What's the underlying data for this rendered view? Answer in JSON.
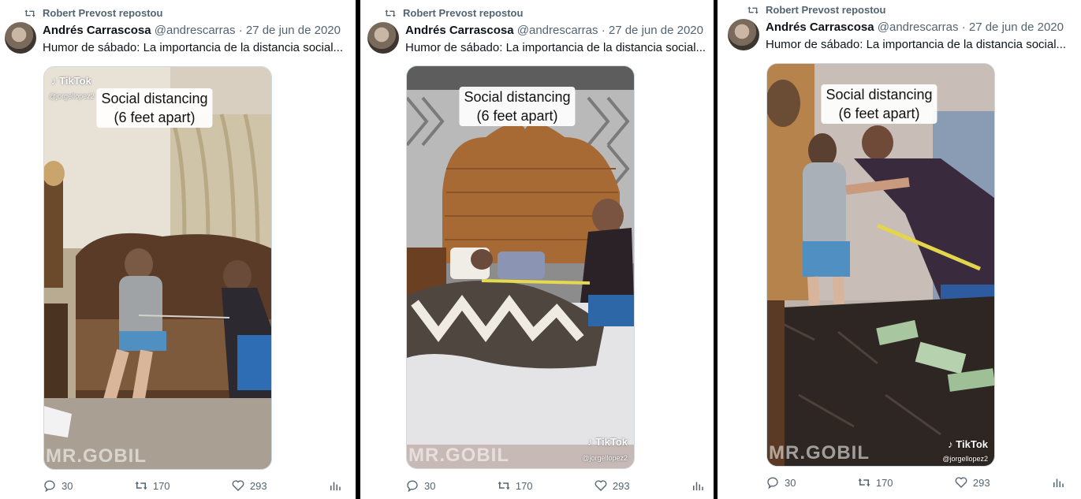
{
  "tweets": [
    {
      "repost_label": "Robert Prevost repostou",
      "author_name": "Andrés Carrascosa",
      "author_handle": "@andrescarras",
      "date": "· 27 de jun de 2020",
      "text": "Humor de sábado: La importancia de la distancia social...",
      "video_caption_line1": "Social distancing",
      "video_caption_line2": "(6 feet apart)",
      "tiktok_label": "TikTok",
      "tiktok_handle": "@jorgellopez2",
      "watermark": "MR.GOBIL",
      "replies": "30",
      "reposts": "170",
      "likes": "293"
    },
    {
      "repost_label": "Robert Prevost repostou",
      "author_name": "Andrés Carrascosa",
      "author_handle": "@andrescarras",
      "date": "· 27 de jun de 2020",
      "text": "Humor de sábado: La importancia de la distancia social...",
      "video_caption_line1": "Social distancing",
      "video_caption_line2": "(6 feet apart)",
      "tiktok_label": "TikTok",
      "tiktok_handle": "@jorgellopez2",
      "watermark": "MR.GOBIL",
      "replies": "30",
      "reposts": "170",
      "likes": "293"
    },
    {
      "repost_label": "Robert Prevost repostou",
      "author_name": "Andrés Carrascosa",
      "author_handle": "@andrescarras",
      "date": "· 27 de jun de 2020",
      "text": "Humor de sábado: La importancia de la distancia social...",
      "video_caption_line1": "Social distancing",
      "video_caption_line2": "(6 feet apart)",
      "tiktok_label": "TikTok",
      "tiktok_handle": "@jorgellopez2",
      "watermark": "MR.GOBIL",
      "replies": "30",
      "reposts": "170",
      "likes": "293"
    }
  ],
  "icons": {
    "repost": "repost-icon",
    "reply": "reply-icon",
    "like": "heart-icon",
    "views": "views-icon"
  },
  "colors": {
    "text_primary": "#0f1419",
    "text_secondary": "#536471",
    "divider": "#000000"
  }
}
